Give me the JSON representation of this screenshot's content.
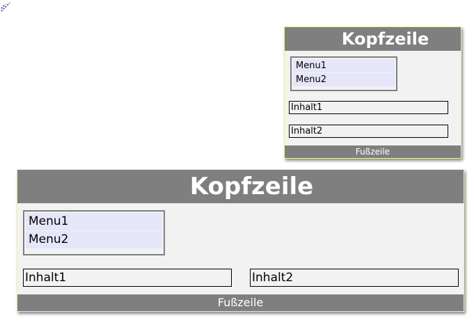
{
  "corner_mark": {
    "icon": "resize-handle-icon",
    "color": "#1a1aa6"
  },
  "colors": {
    "header_footer_bg": "#7f7f7f",
    "page_bg": "#f2f2f2",
    "menu_item_bg": "#e6e6fa",
    "box_border": "#f0f0a8"
  },
  "layouts": {
    "small": {
      "header": "Kopfzeile",
      "menu": [
        "Menu1",
        "Menu2"
      ],
      "content": [
        "Inhalt1",
        "Inhalt2"
      ],
      "footer": "Fußzeile"
    },
    "large": {
      "header": "Kopfzeile",
      "menu": [
        "Menu1",
        "Menu2"
      ],
      "content": [
        "Inhalt1",
        "Inhalt2"
      ],
      "footer": "Fußzeile"
    }
  }
}
